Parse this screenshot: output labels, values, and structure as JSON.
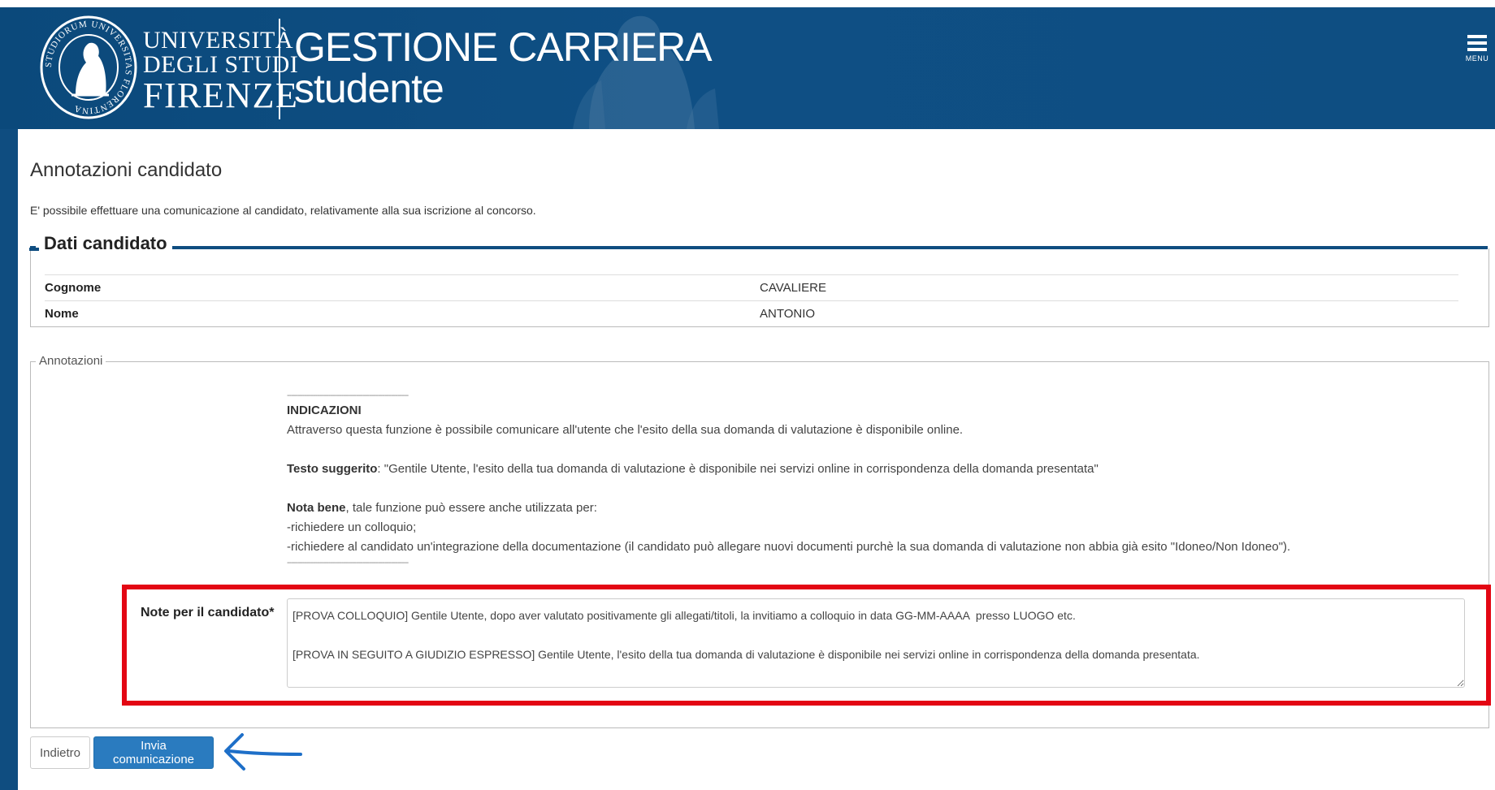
{
  "header": {
    "university_line1": "UNIVERSITÀ",
    "university_line2": "DEGLI STUDI",
    "university_line3": "FIRENZE",
    "app_title_line1": "GESTIONE CARRIERA",
    "app_title_line2": "studente",
    "menu_label": "MENU",
    "seal_text": "STUDIORUM UNIVERSITAS FLORENTINA",
    "seal_icon": "university-seal-icon",
    "menu_icon": "hamburger-menu-icon",
    "brand_color": "#0f4d80"
  },
  "page": {
    "title": "Annotazioni candidato",
    "intro": "E' possibile effettuare una comunicazione al candidato, relativamente alla sua iscrizione al concorso."
  },
  "candidate": {
    "legend": "Dati candidato",
    "rows": [
      {
        "label": "Cognome",
        "value": "CAVALIERE"
      },
      {
        "label": "Nome",
        "value": "ANTONIO"
      }
    ]
  },
  "annotations": {
    "legend": "Annotazioni",
    "separator": "--------------------------------------------------------",
    "heading": "INDICAZIONI",
    "line1": "Attraverso questa funzione è possibile comunicare all'utente che l'esito della sua domanda di valutazione è disponibile online.",
    "suggested_label": "Testo suggerito",
    "suggested_text": ": \"Gentile Utente, l'esito della tua domanda di valutazione è disponibile nei servizi online in corrispondenza della domanda presentata\"",
    "nota_label": "Nota bene",
    "nota_text": ", tale funzione può essere anche utilizzata per:",
    "bullet1": "-richiedere un colloquio;",
    "bullet2": "-richiedere al candidato un'integrazione della documentazione (il candidato può allegare nuovi documenti purchè la sua domanda di valutazione non abbia già esito \"Idoneo/Non Idoneo\").",
    "note_label": "Note per il candidato*",
    "note_value": "[PROVA COLLOQUIO] Gentile Utente, dopo aver valutato positivamente gli allegati/titoli, la invitiamo a colloquio in data GG-MM-AAAA  presso LUOGO etc.\n\n[PROVA IN SEGUITO A GIUDIZIO ESPRESSO] Gentile Utente, l'esito della tua domanda di valutazione è disponibile nei servizi online in corrispondenza della domanda presentata.",
    "highlight_color": "#e30613"
  },
  "actions": {
    "back_label": "Indietro",
    "send_label": "Invia comunicazione",
    "send_color": "#2a7bbf",
    "arrow_color": "#1e6fc8",
    "arrow_icon": "pointer-arrow-icon"
  }
}
